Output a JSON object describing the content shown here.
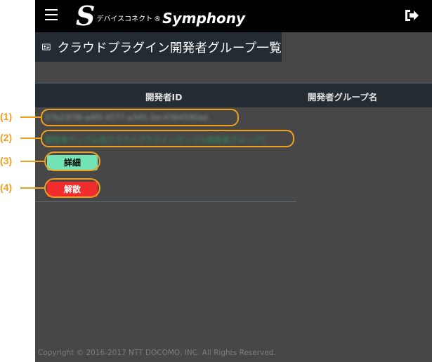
{
  "header": {
    "logo_letter": "S",
    "logo_small": "デバイスコネクト",
    "logo_reg": "®",
    "logo_main": "Symphony"
  },
  "page": {
    "title": "クラウドプラグイン開発者グループ一覧"
  },
  "table": {
    "columns": [
      "開発者ID",
      "開発者グループ名"
    ],
    "rows": [
      {
        "developer_id": "07b23f38-a4f0-4577-a345-3ec4364590ad",
        "group_name": "開発者サンプル用クラウドプラグインサンプル開発者グループ1"
      }
    ]
  },
  "actions": {
    "detail_label": "詳細",
    "dissolve_label": "解散"
  },
  "footer": {
    "copyright": "Copyright © 2016-2017 NTT DOCOMO, INC. All Rights Reserved."
  },
  "annotations": [
    "(1)",
    "(2)",
    "(3)",
    "(4)"
  ],
  "colors": {
    "annotation": "#f0a020",
    "detail_button": "#73e3b6",
    "dissolve_button": "#f02c2c",
    "background": "#474747",
    "header_bg": "#232b33"
  }
}
